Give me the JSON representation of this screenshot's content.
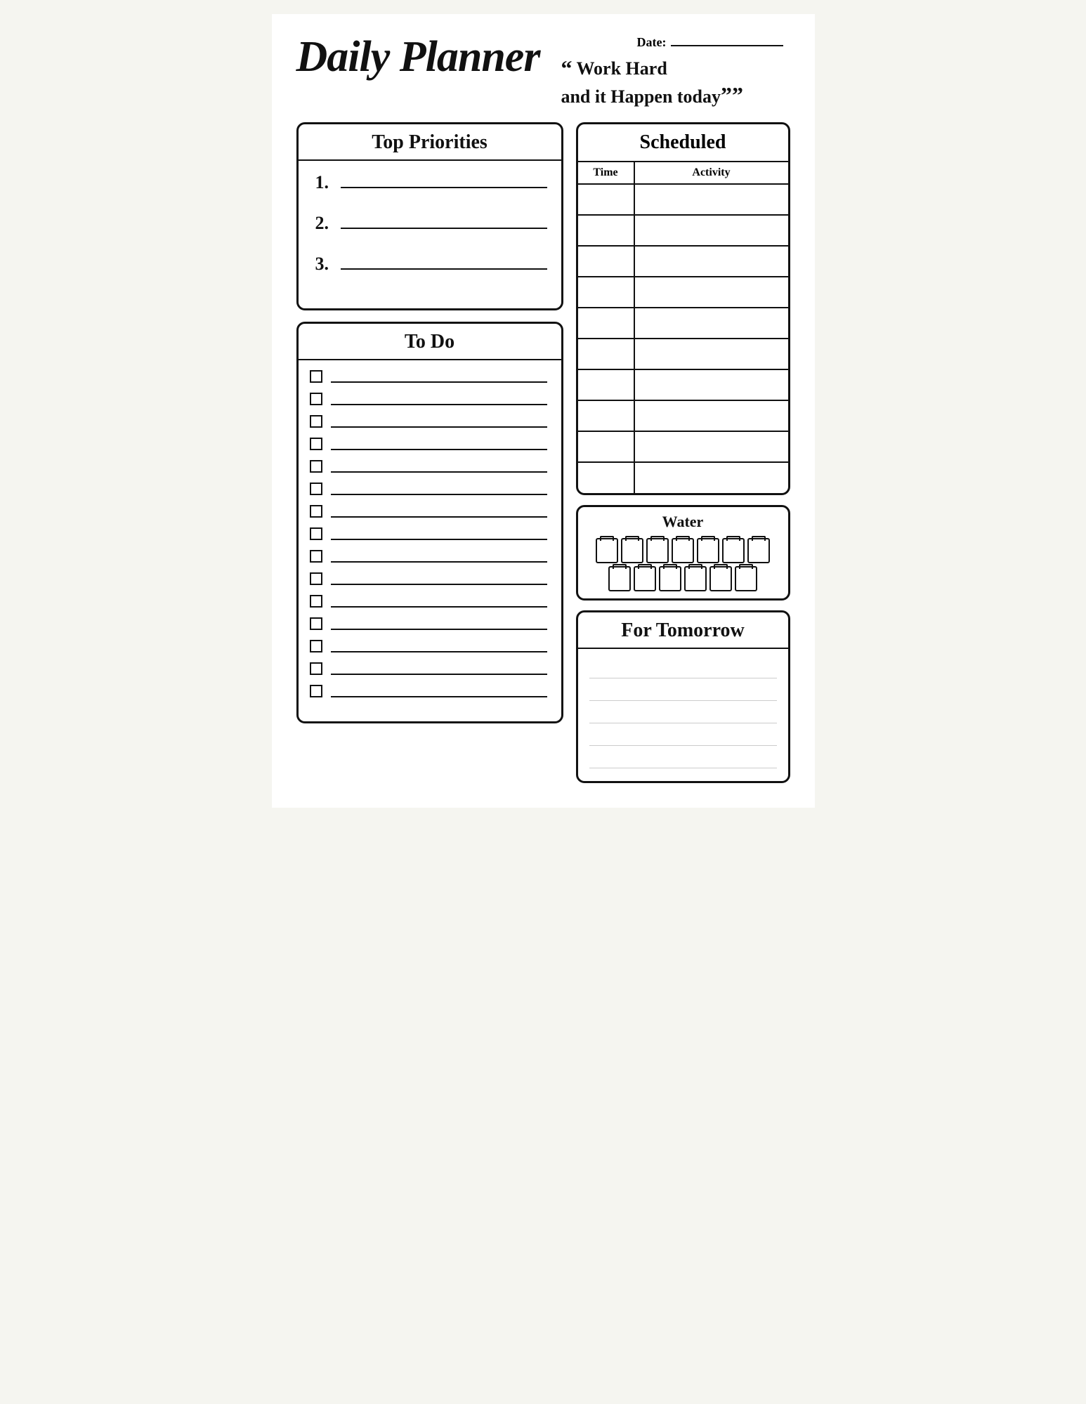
{
  "header": {
    "title": "Daily Planner",
    "date_label": "Date:",
    "quote_open": "“",
    "quote_line1": "Work Hard",
    "quote_line2": "and it Happen today",
    "quote_close": "””"
  },
  "priorities": {
    "section_title": "Top Priorities",
    "items": [
      "1.",
      "2.",
      "3."
    ]
  },
  "todo": {
    "section_title": "To Do",
    "count": 15
  },
  "scheduled": {
    "section_title": "Scheduled",
    "col_time": "Time",
    "col_activity": "Activity",
    "rows": 10
  },
  "water": {
    "section_title": "Water",
    "cups_count": 13
  },
  "tomorrow": {
    "section_title": "For Tomorrow"
  }
}
